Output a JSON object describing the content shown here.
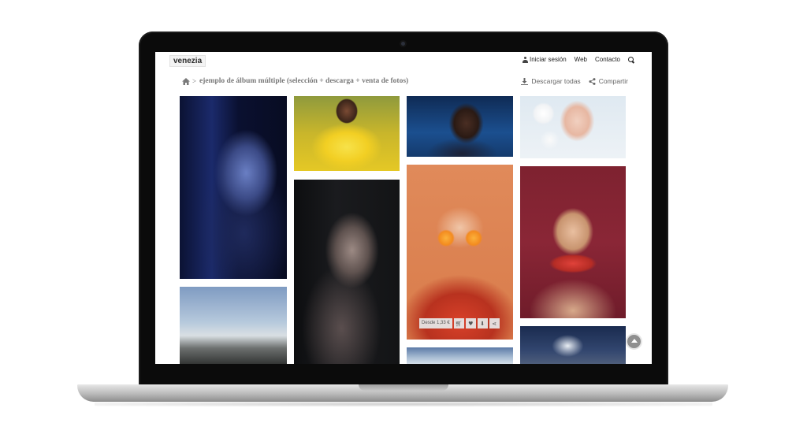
{
  "site": {
    "logo": "venezia"
  },
  "nav": {
    "login": "Iniciar sesión",
    "web": "Web",
    "contact": "Contacto",
    "icons": [
      "user-icon",
      "search-icon"
    ]
  },
  "breadcrumb": {
    "separator": ">",
    "title": "ejemplo de álbum múltiple (selección + descarga + venta de fotos)",
    "icon": "home-icon"
  },
  "actions": {
    "download_all": "Descargar todas",
    "share": "Compartir"
  },
  "hover_bar": {
    "price": "Desde 1,33 €",
    "buttons": [
      "cart-icon",
      "heart-icon",
      "download-icon",
      "share-icon"
    ]
  },
  "photos": [
    "woman with glasses in blue light",
    "man in yellow smoke",
    "woman with sunglasses",
    "woman with flowers",
    "freckled woman in dark",
    "woman with orange slices",
    "woman with watermelon",
    "landscape with power lines",
    "snowy mountains",
    "hands with paper"
  ],
  "colors": {
    "screen_bg": "#ffffff",
    "text_muted": "#7a7a7a",
    "nav_text": "#222222"
  }
}
